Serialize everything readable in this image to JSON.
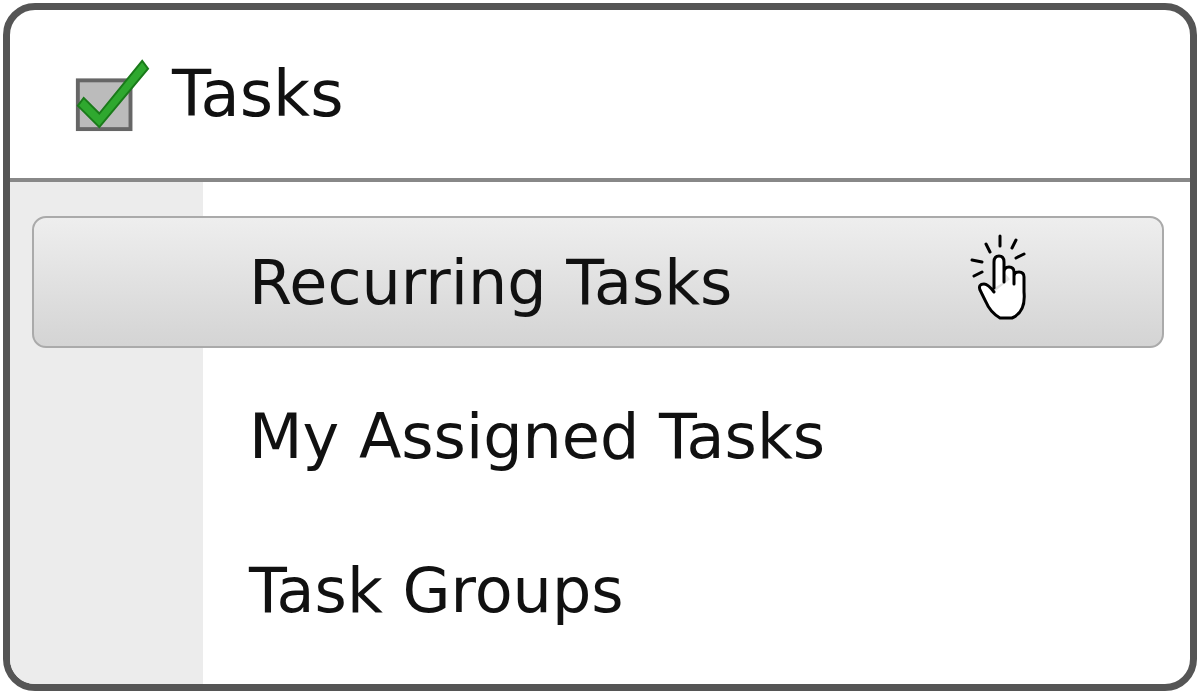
{
  "menu": {
    "title": "Tasks",
    "items": [
      {
        "label": "Recurring Tasks",
        "selected": true
      },
      {
        "label": "My Assigned Tasks",
        "selected": false
      },
      {
        "label": "Task Groups",
        "selected": false
      }
    ]
  }
}
